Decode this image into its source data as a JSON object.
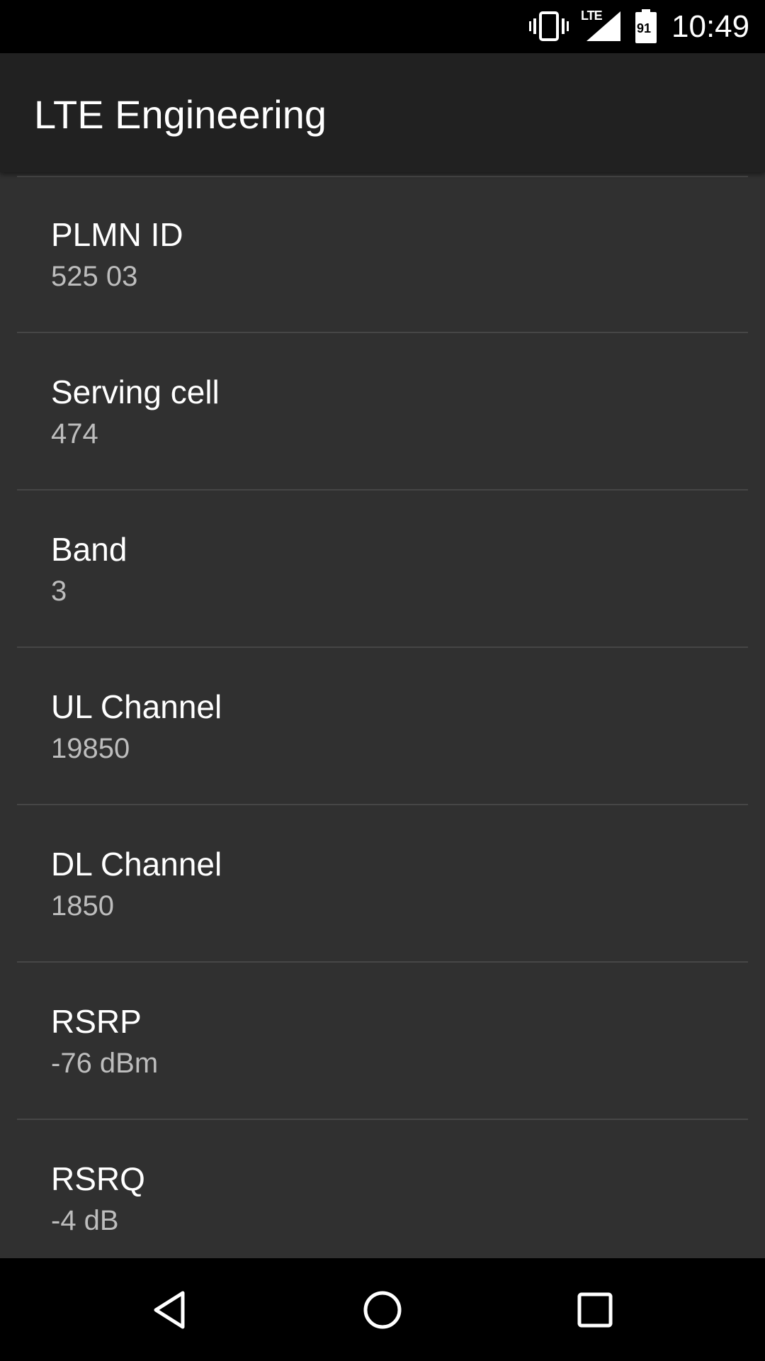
{
  "status_bar": {
    "network_type": "LTE",
    "battery_level": "91",
    "time": "10:49",
    "icons": [
      "vibrate-icon",
      "signal-icon",
      "battery-icon"
    ]
  },
  "app_bar": {
    "title": "LTE Engineering"
  },
  "preferences": [
    {
      "title": "PLMN ID",
      "summary": "525 03"
    },
    {
      "title": "Serving cell",
      "summary": "474"
    },
    {
      "title": "Band",
      "summary": "3"
    },
    {
      "title": "UL Channel",
      "summary": "19850"
    },
    {
      "title": "DL Channel",
      "summary": "1850"
    },
    {
      "title": "RSRP",
      "summary": "-76 dBm"
    },
    {
      "title": "RSRQ",
      "summary": "-4 dB"
    }
  ],
  "navigation": {
    "icons": [
      "back-icon",
      "home-icon",
      "recents-icon"
    ]
  },
  "colors": {
    "background": "#303030",
    "app_bar": "#212121",
    "divider": "#464646",
    "title_text": "#ffffff",
    "summary_text": "#bdbdbd"
  }
}
